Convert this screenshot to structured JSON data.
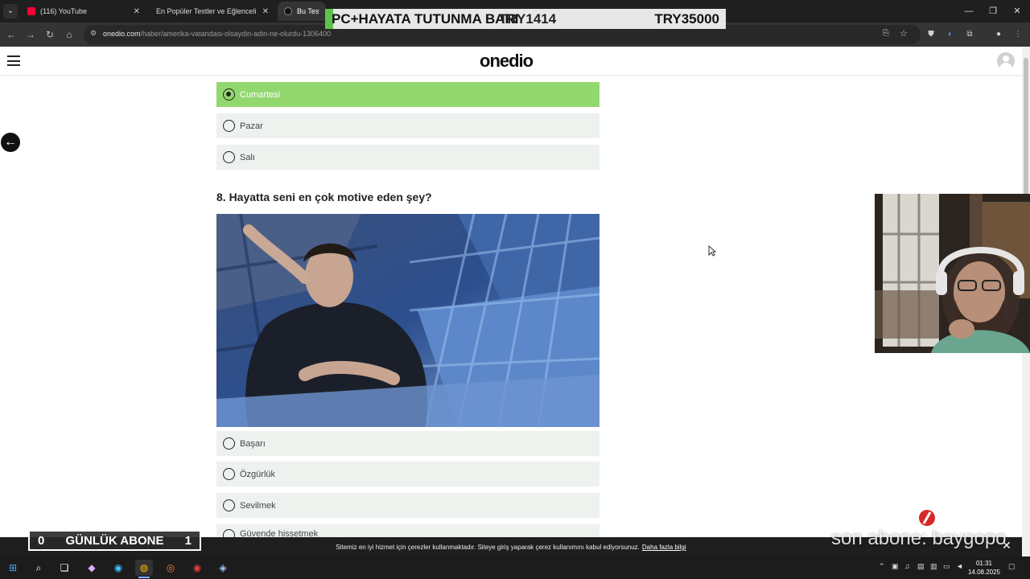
{
  "browser": {
    "tabs": [
      {
        "label": "(116) YouTube",
        "favicon_color": "#ff0033",
        "active": false
      },
      {
        "label": "En Popüler Testler ve Eğlenceli",
        "favicon_color": "#333333",
        "active": false
      },
      {
        "label": "Bu Test Am",
        "favicon_color": "#333333",
        "active": true
      }
    ],
    "url_host": "onedio.com",
    "url_path": "/haber/amerika-vatandasi-olsaydin-adin-ne-olurdu-1306400"
  },
  "stream_banner": {
    "goal_label": "PC+HAYATA TUTUNMA BARI",
    "current": "TRY1414",
    "target": "TRY35000"
  },
  "site": {
    "logo": "onedio",
    "previous_options": [
      {
        "label": "Cumartesi",
        "selected": true
      },
      {
        "label": "Pazar",
        "selected": false
      },
      {
        "label": "Salı",
        "selected": false
      }
    ],
    "question": {
      "title": "8. Hayatta seni en çok motive eden şey?",
      "options": [
        {
          "label": "Başarı"
        },
        {
          "label": "Özgürlük"
        },
        {
          "label": "Sevilmek"
        },
        {
          "label": "Güvende hissetmek"
        }
      ]
    }
  },
  "cookie_bar": {
    "text": "Sitemiz en iyi hizmet için çerezler kullanmaktadır. Siteye giriş yaparak çerez kullanımını kabul ediyorsunuz.",
    "link": "Daha fazla bilgi"
  },
  "overlays": {
    "sub_counter": {
      "left": "0",
      "label": "GÜNLÜK ABONE",
      "right": "1"
    },
    "last_sub": "son abone: baygopo"
  },
  "taskbar": {
    "time": "01:31",
    "date": "14.08.2025"
  },
  "colors": {
    "selected_option": "#93d86e",
    "option_bg": "#eef2ef",
    "banner_accent": "#5ec24a"
  }
}
